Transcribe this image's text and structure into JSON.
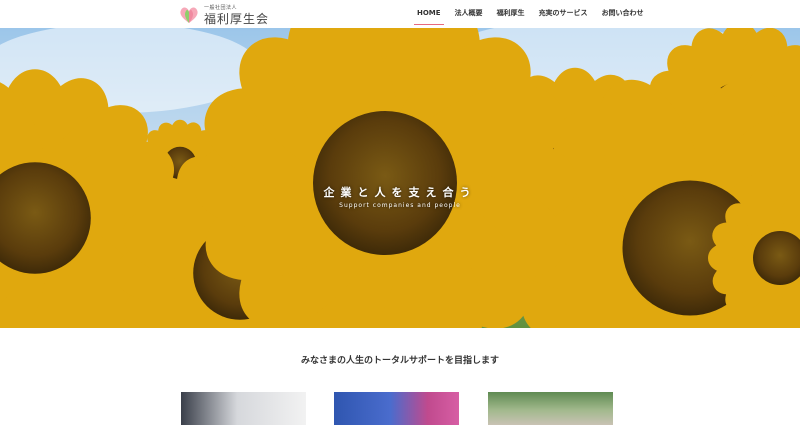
{
  "header": {
    "logo_sub": "一般社団法人",
    "logo_main": "福利厚生会",
    "nav": [
      {
        "label": "HOME",
        "active": true
      },
      {
        "label": "法人概要",
        "active": false
      },
      {
        "label": "福利厚生",
        "active": false
      },
      {
        "label": "充実のサービス",
        "active": false
      },
      {
        "label": "お問い合わせ",
        "active": false
      }
    ]
  },
  "hero": {
    "title": "企業と人を支え合う",
    "subtitle": "Support companies and people"
  },
  "section": {
    "title": "みなさまの人生のトータルサポートを目指します"
  },
  "colors": {
    "accent": "#e86a7d",
    "sunflower": "#f5c518",
    "sunflower_center": "#6b4a12"
  }
}
